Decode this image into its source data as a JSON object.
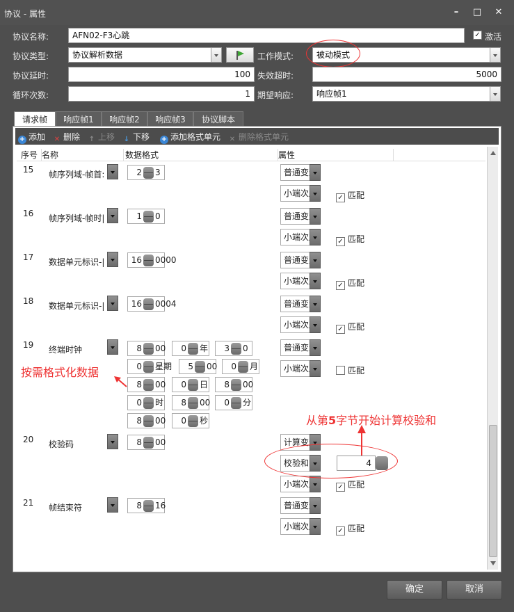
{
  "window": {
    "title": "协议 - 属性"
  },
  "form": {
    "name_label": "协议名称:",
    "name_value": "AFN02-F3心跳",
    "activate_label": "激活",
    "type_label": "协议类型:",
    "type_value": "协议解析数据",
    "work_mode_label": "工作模式:",
    "work_mode_value": "被动模式",
    "delay_label": "协议延时:",
    "delay_value": "100",
    "timeout_label": "失效超时:",
    "timeout_value": "5000",
    "loop_label": "循环次数:",
    "loop_value": "1",
    "expect_label": "期望响应:",
    "expect_value": "响应帧1"
  },
  "tabs": [
    "请求帧",
    "响应帧1",
    "响应帧2",
    "响应帧3",
    "协议脚本"
  ],
  "toolbar": {
    "add": "添加",
    "delete": "删除",
    "up": "上移",
    "down": "下移",
    "add_unit": "添加格式单元",
    "del_unit": "删除格式单元"
  },
  "columns": {
    "seq": "序号",
    "name": "名称",
    "format": "数据格式",
    "attr": "属性"
  },
  "rows": [
    {
      "seq": "15",
      "name": "帧序列域-帧首:",
      "f1": "2",
      "f1s": "3",
      "type": "普通变量",
      "order": "小端次序",
      "match": "匹配"
    },
    {
      "seq": "16",
      "name": "帧序列域-帧时|",
      "f1": "1",
      "f1s": "0",
      "type": "普通变量",
      "order": "小端次序",
      "match": "匹配"
    },
    {
      "seq": "17",
      "name": "数据单元标识-|",
      "f1": "16",
      "f1s": "0000",
      "type": "普通变量",
      "order": "小端次序",
      "match": "匹配"
    },
    {
      "seq": "18",
      "name": "数据单元标识-|",
      "f1": "16",
      "f1s": "0004",
      "type": "普通变量",
      "order": "小端次序",
      "match": "匹配"
    },
    {
      "seq": "19",
      "name": "终端时钟",
      "type": "普通变量",
      "order": "小端次序",
      "match": "匹配"
    },
    {
      "seq": "20",
      "name": "校验码",
      "f1": "8",
      "f1s": "00",
      "type": "计算变量",
      "calc": "校验和",
      "calc_value": "4",
      "order": "小端次序",
      "match": "匹配"
    },
    {
      "seq": "21",
      "name": "帧结束符",
      "f1": "8",
      "f1s": "16",
      "type": "普通变量",
      "order": "小端次序",
      "match": "匹配"
    }
  ],
  "clock": [
    [
      "8",
      "00"
    ],
    [
      "0",
      "年"
    ],
    [
      "3",
      "0"
    ],
    [
      "0",
      "星期"
    ],
    [
      "5",
      "00"
    ],
    [
      "0",
      "月"
    ],
    [
      "8",
      "00"
    ],
    [
      "0",
      "日"
    ],
    [
      "8",
      "00"
    ],
    [
      "0",
      "时"
    ],
    [
      "8",
      "00"
    ],
    [
      "0",
      "分"
    ],
    [
      "8",
      "00"
    ],
    [
      "0",
      "秒"
    ]
  ],
  "annotations": {
    "left": "按需格式化数据",
    "right_a": "从第",
    "right_b": "5",
    "right_c": "字节开始计算校验和"
  },
  "buttons": {
    "ok": "确定",
    "cancel": "取消"
  },
  "colors": {
    "annotation": "#ee3333",
    "background": "#4e4e4e"
  }
}
